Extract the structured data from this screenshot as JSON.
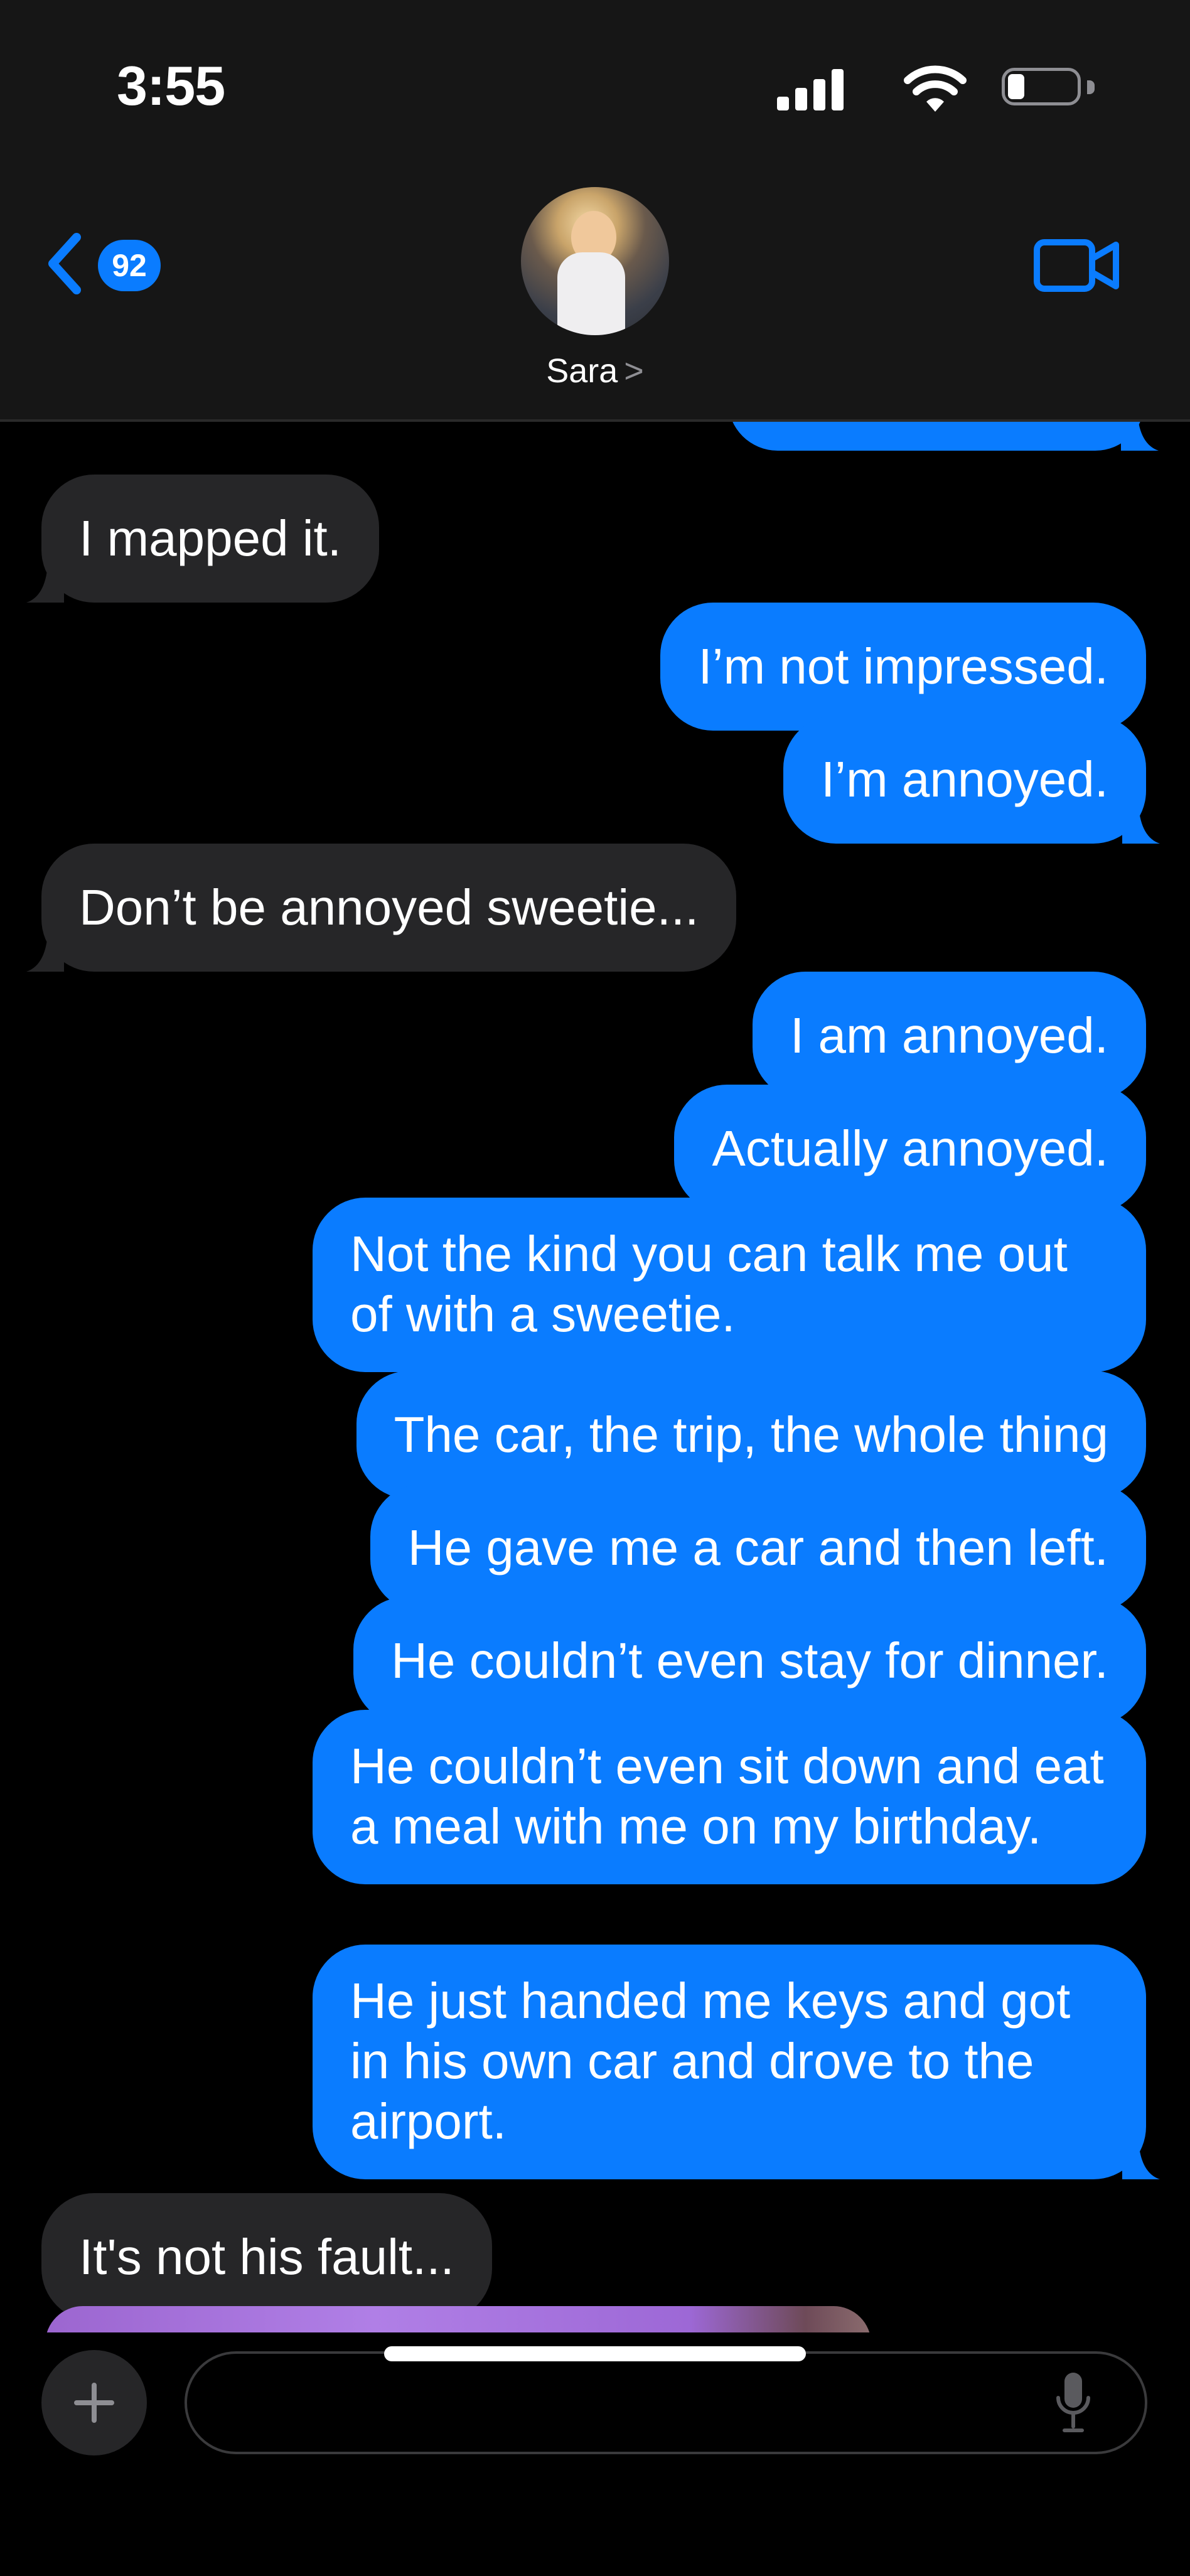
{
  "status_bar": {
    "time": "3:55"
  },
  "header": {
    "back_badge": "92",
    "contact_name": "Sara",
    "contact_chevron": ">"
  },
  "messages": [
    {
      "direction": "in",
      "text": "I mapped it."
    },
    {
      "direction": "out",
      "text": "I’m not impressed."
    },
    {
      "direction": "out",
      "text": "I’m annoyed."
    },
    {
      "direction": "in",
      "text": "Don’t be annoyed sweetie..."
    },
    {
      "direction": "out",
      "text": "I am annoyed."
    },
    {
      "direction": "out",
      "text": "Actually annoyed."
    },
    {
      "direction": "out",
      "text": "Not the kind you can talk me out of with a sweetie."
    },
    {
      "direction": "out",
      "text": "The car, the trip, the whole thing"
    },
    {
      "direction": "out",
      "text": "He gave me a car and then left."
    },
    {
      "direction": "out",
      "text": "He couldn’t even stay for dinner."
    },
    {
      "direction": "out",
      "text": "He couldn’t even sit down and eat a meal with me on my birthday."
    },
    {
      "direction": "out",
      "text": "He just handed me keys and got in his own car and drove to the airport."
    },
    {
      "direction": "in",
      "text": "It's not his fault..."
    }
  ],
  "compose": {
    "placeholder": ""
  },
  "colors": {
    "outgoing": "#0a7cff",
    "incoming": "#262628",
    "background": "#000000"
  }
}
